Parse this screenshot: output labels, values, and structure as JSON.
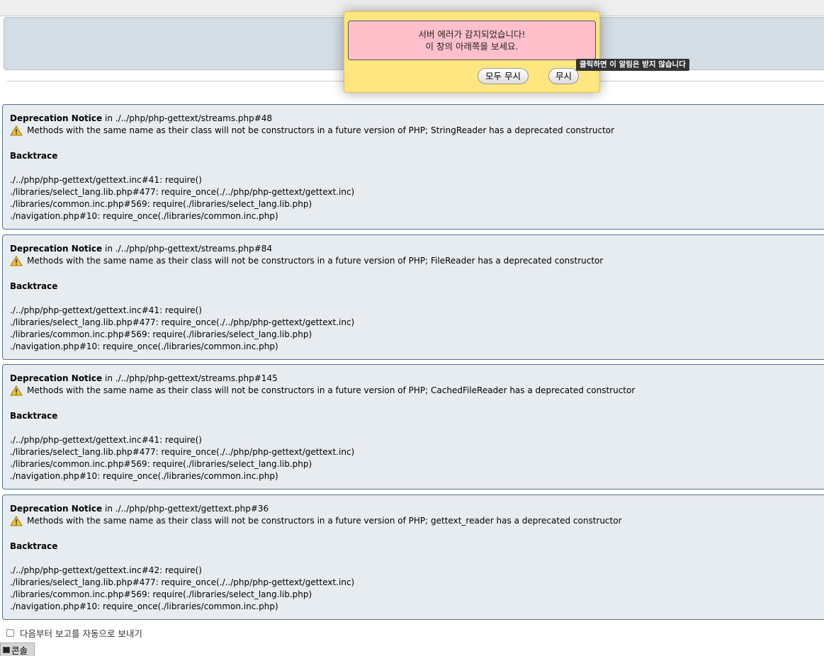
{
  "alert": {
    "line1": "서버 에러가 감지되었습니다!",
    "line2": "이 창의 아래쪽을 보세요.",
    "ignore_all_label": "모두 무시",
    "ignore_label": "무시",
    "tooltip": "클릭하면 이 알림은 받지 않습니다"
  },
  "notices": [
    {
      "type": "Deprecation Notice",
      "in_word": "in",
      "location": "./../php/php-gettext/streams.php#48",
      "message": "Methods with the same name as their class will not be constructors in a future version of PHP; StringReader has a deprecated constructor",
      "backtrace_title": "Backtrace",
      "trace": [
        "./../php/php-gettext/gettext.inc#41: require()",
        "./libraries/select_lang.lib.php#477: require_once(./../php/php-gettext/gettext.inc)",
        "./libraries/common.inc.php#569: require(./libraries/select_lang.lib.php)",
        "./navigation.php#10: require_once(./libraries/common.inc.php)"
      ]
    },
    {
      "type": "Deprecation Notice",
      "in_word": "in",
      "location": "./../php/php-gettext/streams.php#84",
      "message": "Methods with the same name as their class will not be constructors in a future version of PHP; FileReader has a deprecated constructor",
      "backtrace_title": "Backtrace",
      "trace": [
        "./../php/php-gettext/gettext.inc#41: require()",
        "./libraries/select_lang.lib.php#477: require_once(./../php/php-gettext/gettext.inc)",
        "./libraries/common.inc.php#569: require(./libraries/select_lang.lib.php)",
        "./navigation.php#10: require_once(./libraries/common.inc.php)"
      ]
    },
    {
      "type": "Deprecation Notice",
      "in_word": "in",
      "location": "./../php/php-gettext/streams.php#145",
      "message": "Methods with the same name as their class will not be constructors in a future version of PHP; CachedFileReader has a deprecated constructor",
      "backtrace_title": "Backtrace",
      "trace": [
        "./../php/php-gettext/gettext.inc#41: require()",
        "./libraries/select_lang.lib.php#477: require_once(./../php/php-gettext/gettext.inc)",
        "./libraries/common.inc.php#569: require(./libraries/select_lang.lib.php)",
        "./navigation.php#10: require_once(./libraries/common.inc.php)"
      ]
    },
    {
      "type": "Deprecation Notice",
      "in_word": "in",
      "location": "./../php/php-gettext/gettext.php#36",
      "message": "Methods with the same name as their class will not be constructors in a future version of PHP; gettext_reader has a deprecated constructor",
      "backtrace_title": "Backtrace",
      "trace": [
        "./../php/php-gettext/gettext.inc#42: require()",
        "./libraries/select_lang.lib.php#477: require_once(./../php/php-gettext/gettext.inc)",
        "./libraries/common.inc.php#569: require(./libraries/select_lang.lib.php)",
        "./navigation.php#10: require_once(./libraries/common.inc.php)"
      ]
    }
  ],
  "auto_report_label": "다음부터 보고를 자동으로 보내기",
  "auto_report_checked": false,
  "console_label": "콘솔",
  "icons": {
    "warning": "warning-icon",
    "console": "console-icon"
  },
  "colors": {
    "alert_bg": "#ffe680",
    "alert_msg_bg": "#ffc0cb",
    "notice_bg": "#e7ecf1",
    "notice_border": "#54738f"
  }
}
